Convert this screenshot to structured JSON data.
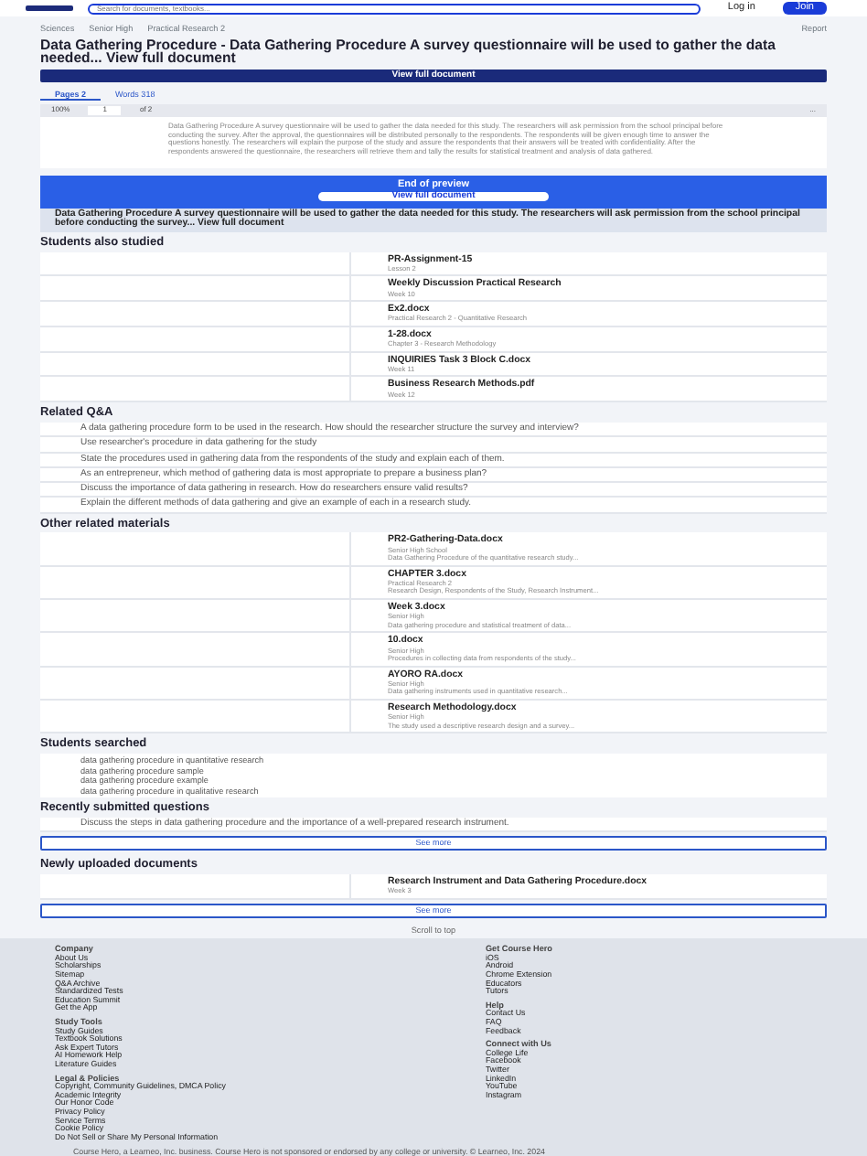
{
  "top_nav": {
    "search": {
      "placeholder": "Search for documents, textbooks..."
    },
    "buttons": [
      "Log in",
      "Join"
    ]
  },
  "breadcrumbs": [
    "Sciences",
    "Senior High",
    "Practical Research 2"
  ],
  "report_link": "Report",
  "title": "Data Gathering Procedure - Data Gathering Procedure A survey questionnaire will be used to gather the data needed... View full document",
  "view_full_button": "View full document",
  "doc_tabs": [
    {
      "label": "Pages 2",
      "selected": true
    },
    {
      "label": "Words 318",
      "selected": false
    }
  ],
  "viewer": {
    "zoom": "100%",
    "page": "1",
    "of": "of 2",
    "menu": "..."
  },
  "preview_text": "Data Gathering Procedure A survey questionnaire will be used to gather the data needed for this study. The researchers will ask permission from the school principal before conducting the survey. After the approval, the questionnaires will be distributed personally to the respondents. The respondents will be given enough time to answer the questions honestly. The researchers will explain the purpose of the study and assure the respondents that their answers will be treated with confidentiality. After the respondents answered the questionnaire, the researchers will retrieve them and tally the results for statistical treatment and analysis of data gathered.",
  "end_preview": {
    "title": "End of preview",
    "button": "View full document"
  },
  "snippet": {
    "text": "Data Gathering Procedure A survey questionnaire will be used to gather the data needed for this study. The researchers will ask permission from the school principal before conducting the survey...",
    "link": "View full document"
  },
  "students_also_studied": {
    "heading": "Students also studied",
    "items": [
      {
        "title": "PR-Assignment-15",
        "meta": "Lesson 2"
      },
      {
        "title": "Weekly Discussion Practical Research",
        "meta": "Week 10"
      },
      {
        "title": "Ex2.docx",
        "meta": "Practical Research 2 - Quantitative Research"
      },
      {
        "title": "1-28.docx",
        "meta": "Chapter 3 - Research Methodology"
      },
      {
        "title": "INQUIRIES Task 3 Block C.docx",
        "meta": "Week 11"
      },
      {
        "title": "Business Research Methods.pdf",
        "meta": "Week 12"
      }
    ]
  },
  "related_qa": {
    "heading": "Related Q&A",
    "items": [
      "A data gathering procedure form to be used in the research. How should the researcher structure the survey and interview?",
      "Use researcher's procedure in data gathering for the study",
      "State the procedures used in gathering data from the respondents of the study and explain each of them.",
      "As an entrepreneur, which method of gathering data is most appropriate to prepare a business plan?",
      "Discuss the importance of data gathering in research. How do researchers ensure valid results?",
      "Explain the different methods of data gathering and give an example of each in a research study."
    ]
  },
  "other_materials": {
    "heading": "Other related materials",
    "items": [
      {
        "title": "PR2-Gathering-Data.docx",
        "meta": "Senior High School",
        "desc": "Data Gathering Procedure of the quantitative research study..."
      },
      {
        "title": "CHAPTER 3.docx",
        "meta": "Practical Research 2",
        "desc": "Research Design, Respondents of the Study, Research Instrument..."
      },
      {
        "title": "Week 3.docx",
        "meta": "Senior High",
        "desc": "Data gathering procedure and statistical treatment of data..."
      },
      {
        "title": "10.docx",
        "meta": "Senior High",
        "desc": "Procedures in collecting data from respondents of the study..."
      },
      {
        "title": "AYORO RA.docx",
        "meta": "Senior High",
        "desc": "Data gathering instruments used in quantitative research..."
      },
      {
        "title": "Research Methodology.docx",
        "meta": "Senior High",
        "desc": "The study used a descriptive research design and a survey..."
      }
    ]
  },
  "students_searched": {
    "heading": "Students searched",
    "items": [
      "data gathering procedure in quantitative research",
      "data gathering procedure sample",
      "data gathering procedure example",
      "data gathering procedure in qualitative research"
    ]
  },
  "recent_questions": {
    "heading": "Recently submitted questions",
    "text": "Discuss the steps in data gathering procedure and the importance of a well-prepared research instrument.",
    "button": "See more"
  },
  "new_documents": {
    "heading": "Newly uploaded documents",
    "items": [
      {
        "title": "Research Instrument and Data Gathering Procedure.docx",
        "meta": "Week 3"
      }
    ],
    "button": "See more"
  },
  "scroll_top": "Scroll to top",
  "footer": {
    "columns": [
      {
        "groups": [
          {
            "title": "Company",
            "links": [
              "About Us",
              "Scholarships",
              "Sitemap",
              "Q&A Archive",
              "Standardized Tests",
              "Education Summit",
              "Get the App"
            ]
          },
          {
            "title": "Study Tools",
            "links": [
              "Study Guides",
              "Textbook Solutions",
              "Ask Expert Tutors",
              "AI Homework Help",
              "Literature Guides"
            ]
          },
          {
            "title": "Legal & Policies",
            "links": [
              "Copyright, Community Guidelines, DMCA Policy",
              "Academic Integrity",
              "Our Honor Code",
              "Privacy Policy",
              "Service Terms",
              "Cookie Policy",
              "Do Not Sell or Share My Personal Information"
            ]
          }
        ]
      },
      {
        "groups": [
          {
            "title": "Get Course Hero",
            "links": [
              "iOS",
              "Android",
              "Chrome Extension",
              "Educators",
              "Tutors"
            ]
          },
          {
            "title": "Help",
            "links": [
              "Contact Us",
              "FAQ",
              "Feedback"
            ]
          },
          {
            "title": "Connect with Us",
            "links": [
              "College Life",
              "Facebook",
              "Twitter",
              "LinkedIn",
              "YouTube",
              "Instagram"
            ]
          }
        ]
      }
    ],
    "copyright": "Course Hero, a Learneo, Inc. business. Course Hero is not sponsored or endorsed by any college or university. © Learneo, Inc. 2024"
  }
}
